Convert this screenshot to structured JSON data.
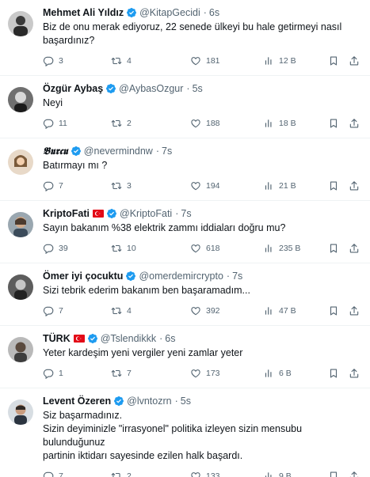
{
  "tweets": [
    {
      "name": "Mehmet Ali Yıldız",
      "handle": "@KitapGecidi",
      "time": "6s",
      "flag": false,
      "gothic": false,
      "lines": [
        "Biz de onu merak ediyoruz, 22 senede ülkeyi bu hale getirmeyi nasıl",
        "başardınız?"
      ],
      "replies": "3",
      "retweets": "4",
      "likes": "181",
      "views": "12 B"
    },
    {
      "name": "Özgür Aybaş",
      "handle": "@AybasOzgur",
      "time": "5s",
      "flag": false,
      "gothic": false,
      "lines": [
        "Neyi"
      ],
      "replies": "11",
      "retweets": "2",
      "likes": "188",
      "views": "18 B"
    },
    {
      "name": "𝕭𝖚𝖗𝖈𝖚",
      "handle": "@nevermindnw",
      "time": "7s",
      "flag": false,
      "gothic": true,
      "lines": [
        "Batırmayı mı ?"
      ],
      "replies": "7",
      "retweets": "3",
      "likes": "194",
      "views": "21 B"
    },
    {
      "name": "KriptoFati",
      "handle": "@KriptoFati",
      "time": "7s",
      "flag": true,
      "gothic": false,
      "lines": [
        "Sayın bakanım %38 elektrik zammı iddiaları doğru mu?"
      ],
      "replies": "39",
      "retweets": "10",
      "likes": "618",
      "views": "235 B"
    },
    {
      "name": "Ömer iyi çocuktu",
      "handle": "@omerdemircrypto",
      "time": "7s",
      "flag": false,
      "gothic": false,
      "lines": [
        "Sizi tebrik ederim bakanım ben başaramadım..."
      ],
      "replies": "7",
      "retweets": "4",
      "likes": "392",
      "views": "47 B"
    },
    {
      "name": "TÜRK",
      "handle": "@Tslendikkk",
      "time": "6s",
      "flag": true,
      "gothic": false,
      "lines": [
        "Yeter kardeşim yeni vergiler yeni zamlar yeter"
      ],
      "replies": "1",
      "retweets": "7",
      "likes": "173",
      "views": "6 B"
    },
    {
      "name": "Levent Özeren",
      "handle": "@lvntozrn",
      "time": "5s",
      "flag": false,
      "gothic": false,
      "lines": [
        "Siz başarmadınız.",
        "Sizin deyiminizle \"irrasyonel\" politika izleyen sizin mensubu bulunduğunuz",
        "partinin iktidarı sayesinde ezilen halk başardı."
      ],
      "replies": "7",
      "retweets": "2",
      "likes": "133",
      "views": "9 B"
    }
  ],
  "colors": {
    "verified": "#1d9bf0",
    "flag": "#e30a17",
    "muted": "#536471",
    "text": "#0f1419",
    "divider": "#eff3f4"
  },
  "icons": [
    "verified-badge-icon",
    "turkey-flag-icon",
    "reply-icon",
    "retweet-icon",
    "like-icon",
    "views-icon",
    "bookmark-icon",
    "share-icon"
  ]
}
